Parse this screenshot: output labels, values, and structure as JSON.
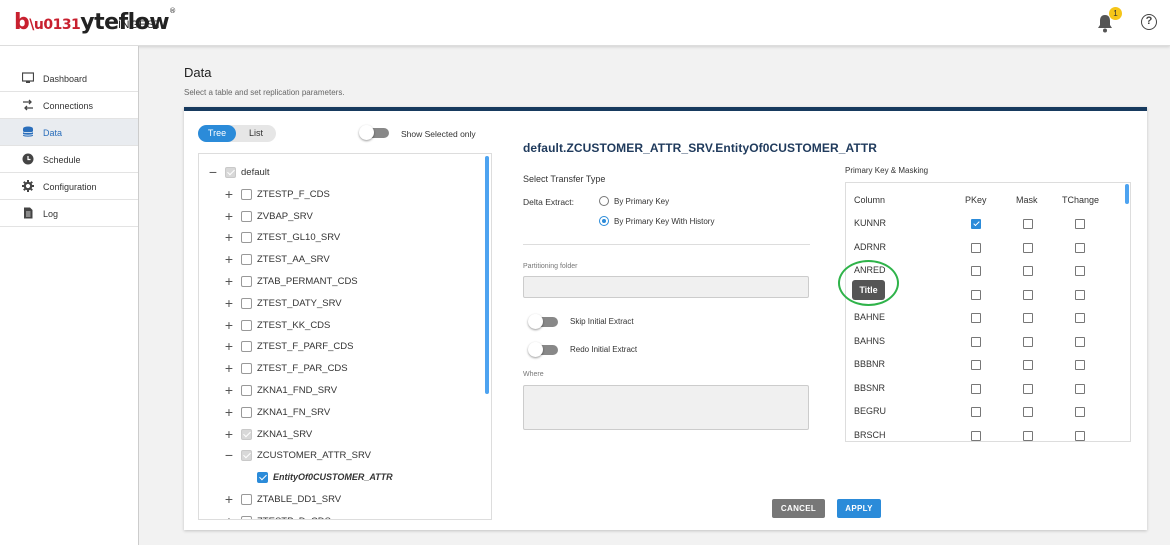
{
  "app": {
    "logo_main": "byteflow",
    "logo_sub": "INGEST",
    "notif_count": "1",
    "help_glyph": "?"
  },
  "sidebar": {
    "items": [
      {
        "label": "Dashboard",
        "icon": "monitor-icon",
        "active": false
      },
      {
        "label": "Connections",
        "icon": "connections-icon",
        "active": false
      },
      {
        "label": "Data",
        "icon": "database-icon",
        "active": true
      },
      {
        "label": "Schedule",
        "icon": "clock-icon",
        "active": false
      },
      {
        "label": "Configuration",
        "icon": "gear-icon",
        "active": false
      },
      {
        "label": "Log",
        "icon": "document-icon",
        "active": false
      }
    ]
  },
  "page": {
    "title": "Data",
    "subtitle": "Select a table and set replication parameters."
  },
  "tree_panel": {
    "tab_tree": "Tree",
    "tab_list": "List",
    "show_selected_label": "Show Selected only",
    "show_selected_on": false,
    "nodes": [
      {
        "label": "default",
        "expander": "−",
        "check": "grey",
        "level": 0
      },
      {
        "label": "ZTESTP_F_CDS",
        "expander": "+",
        "check": "none",
        "level": 1
      },
      {
        "label": "ZVBAP_SRV",
        "expander": "+",
        "check": "none",
        "level": 1
      },
      {
        "label": "ZTEST_GL10_SRV",
        "expander": "+",
        "check": "none",
        "level": 1
      },
      {
        "label": "ZTEST_AA_SRV",
        "expander": "+",
        "check": "none",
        "level": 1
      },
      {
        "label": "ZTAB_PERMANT_CDS",
        "expander": "+",
        "check": "none",
        "level": 1
      },
      {
        "label": "ZTEST_DATY_SRV",
        "expander": "+",
        "check": "none",
        "level": 1
      },
      {
        "label": "ZTEST_KK_CDS",
        "expander": "+",
        "check": "none",
        "level": 1
      },
      {
        "label": "ZTEST_F_PARF_CDS",
        "expander": "+",
        "check": "none",
        "level": 1
      },
      {
        "label": "ZTEST_F_PAR_CDS",
        "expander": "+",
        "check": "none",
        "level": 1
      },
      {
        "label": "ZKNA1_FND_SRV",
        "expander": "+",
        "check": "none",
        "level": 1
      },
      {
        "label": "ZKNA1_FN_SRV",
        "expander": "+",
        "check": "none",
        "level": 1
      },
      {
        "label": "ZKNA1_SRV",
        "expander": "+",
        "check": "grey",
        "level": 1
      },
      {
        "label": "ZCUSTOMER_ATTR_SRV",
        "expander": "−",
        "check": "grey",
        "level": 1
      },
      {
        "label": "EntityOf0CUSTOMER_ATTR",
        "expander": "",
        "check": "blue",
        "level": 2
      },
      {
        "label": "ZTABLE_DD1_SRV",
        "expander": "+",
        "check": "none",
        "level": 1
      },
      {
        "label": "ZTESTP_D_CDS",
        "expander": "+",
        "check": "none",
        "level": 1
      }
    ]
  },
  "entity": {
    "title": "default.ZCUSTOMER_ATTR_SRV.EntityOf0CUSTOMER_ATTR",
    "transfer_type_label": "Select Transfer Type",
    "delta_label": "Delta Extract:",
    "option_pk": "By Primary Key",
    "option_pk_history": "By Primary Key With History",
    "selected_option": "By Primary Key With History",
    "partition_label": "Partitioning folder",
    "partition_value": "",
    "skip_label": "Skip Initial Extract",
    "redo_label": "Redo Initial Extract",
    "where_label": "Where",
    "where_value": ""
  },
  "pk_panel": {
    "title": "Primary Key & Masking",
    "headers": {
      "column": "Column",
      "pkey": "PKey",
      "mask": "Mask",
      "tchange": "TChange"
    },
    "rows": [
      {
        "name": "KUNNR",
        "pkey": true,
        "mask": false,
        "tchange": false
      },
      {
        "name": "ADRNR",
        "pkey": false,
        "mask": false,
        "tchange": false
      },
      {
        "name": "ANRED",
        "pkey": false,
        "mask": false,
        "tchange": false
      },
      {
        "name": "",
        "pkey": false,
        "mask": false,
        "tchange": false
      },
      {
        "name": "BAHNE",
        "pkey": false,
        "mask": false,
        "tchange": false
      },
      {
        "name": "BAHNS",
        "pkey": false,
        "mask": false,
        "tchange": false
      },
      {
        "name": "BBBNR",
        "pkey": false,
        "mask": false,
        "tchange": false
      },
      {
        "name": "BBSNR",
        "pkey": false,
        "mask": false,
        "tchange": false
      },
      {
        "name": "BEGRU",
        "pkey": false,
        "mask": false,
        "tchange": false
      },
      {
        "name": "BRSCH",
        "pkey": false,
        "mask": false,
        "tchange": false
      }
    ],
    "tooltip": "Title"
  },
  "actions": {
    "cancel": "CANCEL",
    "apply": "APPLY"
  }
}
